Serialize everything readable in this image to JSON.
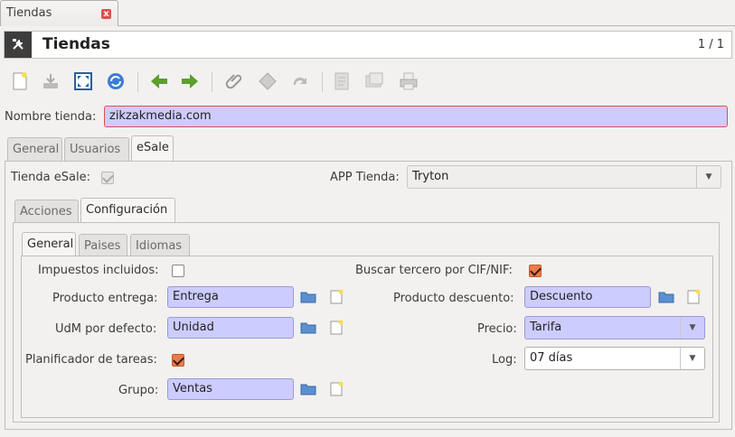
{
  "doc_tab": {
    "label": "Tiendas",
    "close_glyph": "x"
  },
  "header": {
    "title": "Tiendas",
    "record_count": "1 / 1",
    "icon": "tools-icon"
  },
  "toolbar": {
    "buttons": [
      {
        "name": "new-record-button",
        "icon": "new-document-icon"
      },
      {
        "name": "save-button",
        "icon": "save-icon"
      },
      {
        "name": "switch-view-button",
        "icon": "fullscreen-icon"
      },
      {
        "name": "reload-button",
        "icon": "refresh-icon"
      },
      {
        "name": "previous-button",
        "icon": "arrow-left-icon"
      },
      {
        "name": "next-button",
        "icon": "arrow-right-icon"
      },
      {
        "name": "attachment-button",
        "icon": "paperclip-icon"
      },
      {
        "name": "action-button",
        "icon": "gear-icon"
      },
      {
        "name": "relate-button",
        "icon": "redo-icon"
      },
      {
        "name": "report-button",
        "icon": "report-icon"
      },
      {
        "name": "email-button",
        "icon": "email-icon"
      },
      {
        "name": "print-button",
        "icon": "print-icon"
      }
    ]
  },
  "form": {
    "name_label": "Nombre tienda:",
    "name_value": "zikzakmedia.com",
    "tabs": [
      "General",
      "Usuarios",
      "eSale"
    ],
    "active_tab": "eSale",
    "esale": {
      "tienda_esale_label": "Tienda eSale:",
      "tienda_esale_checked": true,
      "app_label": "APP Tienda:",
      "app_value": "Tryton",
      "subtabs": [
        "Acciones",
        "Configuración"
      ],
      "active_subtab": "Configuración",
      "config": {
        "subtabs": [
          "General",
          "Paises",
          "Idiomas"
        ],
        "active_subtab": "General",
        "impuestos_label": "Impuestos incluidos:",
        "impuestos_checked": false,
        "buscar_label": "Buscar tercero por CIF/NIF:",
        "buscar_checked": true,
        "producto_entrega_label": "Producto entrega:",
        "producto_entrega_value": "Entrega",
        "producto_descuento_label": "Producto descuento:",
        "producto_descuento_value": "Descuento",
        "udm_label": "UdM por defecto:",
        "udm_value": "Unidad",
        "precio_label": "Precio:",
        "precio_value": "Tarifa",
        "planificador_label": "Planificador de tareas:",
        "planificador_checked": true,
        "log_label": "Log:",
        "log_value": "07 días",
        "grupo_label": "Grupo:",
        "grupo_value": "Ventas"
      }
    }
  },
  "colors": {
    "required_field": "#ccccff",
    "checkbox_checked": "#ec7a4a",
    "error_border": "#d9534f",
    "title_icon_bg": "#3d3d3d"
  }
}
